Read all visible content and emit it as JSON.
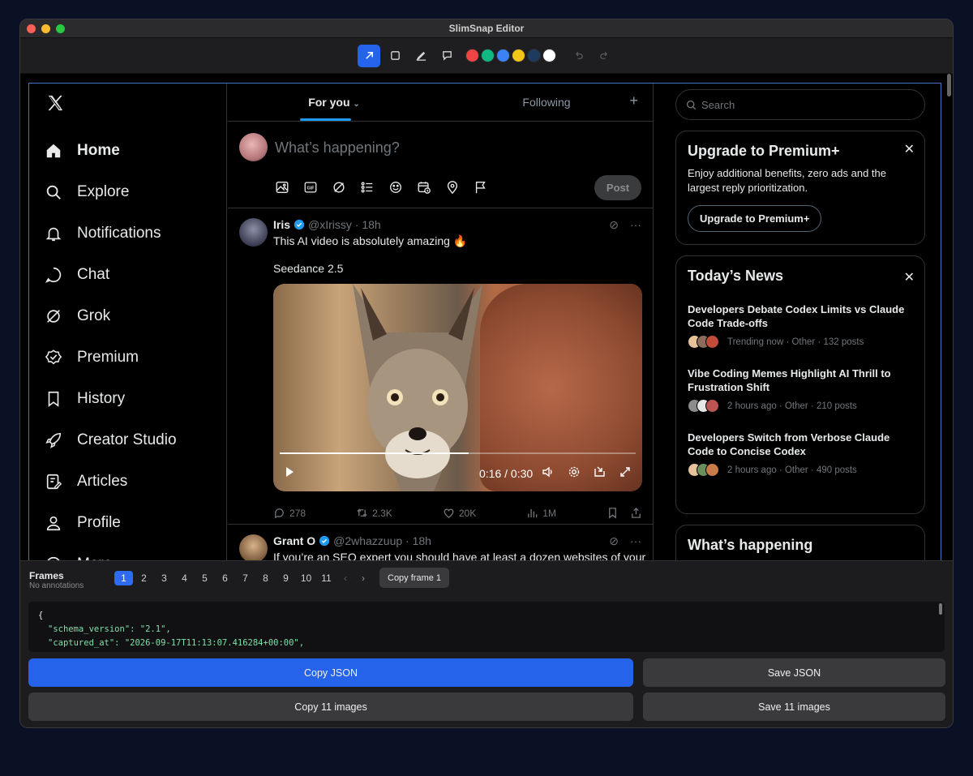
{
  "window": {
    "title": "SlimSnap Editor"
  },
  "toolbar": {
    "tools": [
      "arrow-tool",
      "rectangle-tool",
      "pen-tool",
      "comment-tool"
    ],
    "colors": [
      "#ef4444",
      "#10b981",
      "#3b82f6",
      "#f5c518",
      "#1e3a5f",
      "#ffffff"
    ]
  },
  "x": {
    "nav": [
      {
        "label": "Home",
        "icon": "home-icon"
      },
      {
        "label": "Explore",
        "icon": "search-icon"
      },
      {
        "label": "Notifications",
        "icon": "bell-icon"
      },
      {
        "label": "Chat",
        "icon": "chat-icon"
      },
      {
        "label": "Grok",
        "icon": "grok-icon"
      },
      {
        "label": "Premium",
        "icon": "premium-icon"
      },
      {
        "label": "History",
        "icon": "bookmark-icon"
      },
      {
        "label": "Creator Studio",
        "icon": "rocket-icon"
      },
      {
        "label": "Articles",
        "icon": "article-icon"
      },
      {
        "label": "Profile",
        "icon": "person-icon"
      },
      {
        "label": "More",
        "icon": "more-icon"
      }
    ],
    "tabs": {
      "for_you": "For you",
      "following": "Following"
    },
    "compose": {
      "placeholder": "What’s happening?",
      "post_label": "Post"
    },
    "tweet1": {
      "name": "Iris",
      "meta": "@xIrissy · 18h",
      "text": "This AI video is absolutely amazing 🔥",
      "text2": "Seedance 2.5",
      "video_time": "0:16 / 0:30",
      "video_progress": 0.53,
      "replies": "278",
      "reposts": "2.3K",
      "likes": "20K",
      "views": "1M"
    },
    "tweet2": {
      "name": "Grant O",
      "meta": "@2whazzuup · 18h",
      "text": "If you’re an SEO expert you should have at least a dozen websites of your"
    },
    "rail": {
      "search_placeholder": "Search",
      "premium": {
        "title": "Upgrade to Premium+",
        "body": "Enjoy additional benefits, zero ads and the largest reply prioritization.",
        "button": "Upgrade to Premium+"
      },
      "news": {
        "title": "Today’s News",
        "items": [
          {
            "title": "Developers Debate Codex Limits vs Claude Code Trade-offs",
            "meta": "Trending now · Other · 132 posts"
          },
          {
            "title": "Vibe Coding Memes Highlight AI Thrill to Frustration Shift",
            "meta": "2 hours ago · Other · 210 posts"
          },
          {
            "title": "Developers Switch from Verbose Claude Code to Concise Codex",
            "meta": "2 hours ago · Other · 490 posts"
          }
        ]
      },
      "happening_title": "What’s happening"
    }
  },
  "panel": {
    "frames_label": "Frames",
    "frames_sub": "No annotations",
    "pages": [
      "1",
      "2",
      "3",
      "4",
      "5",
      "6",
      "7",
      "8",
      "9",
      "10",
      "11"
    ],
    "active_page": "1",
    "copy_frame": "Copy frame 1",
    "json_lines": [
      "{",
      "\"schema_version\": \"2.1\",",
      "\"captured_at\": \"2026-09-17T11:13:07.416284+00:00\","
    ],
    "buttons": {
      "copy_json": "Copy JSON",
      "save_json": "Save JSON",
      "copy_images": "Copy 11 images",
      "save_images": "Save 11 images"
    }
  }
}
